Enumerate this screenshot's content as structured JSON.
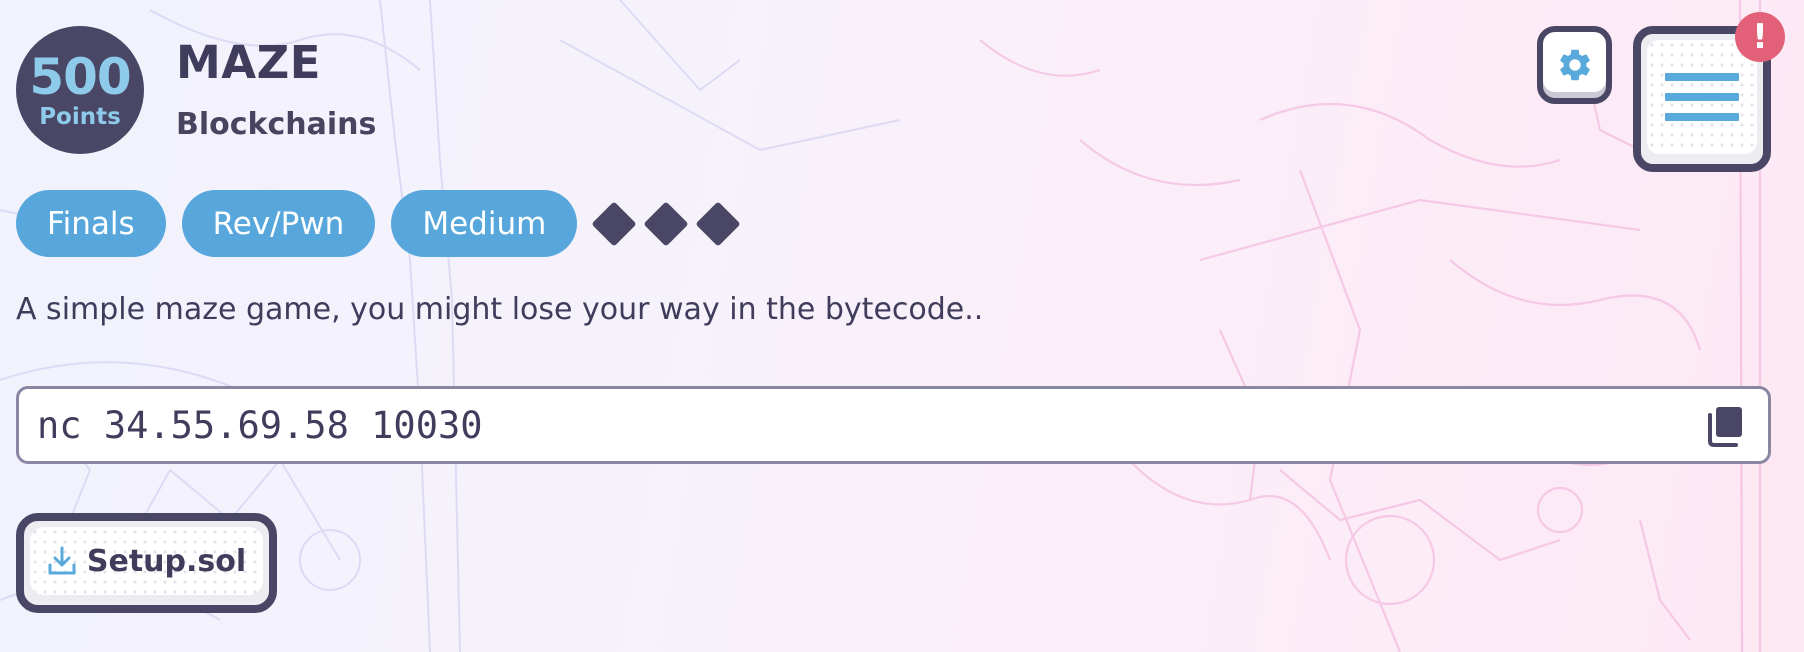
{
  "challenge": {
    "points_value": "500",
    "points_label": "Points",
    "title": "MAZE",
    "category": "Blockchains",
    "tags": [
      "Finals",
      "Rev/Pwn",
      "Medium"
    ],
    "difficulty_diamonds": 3,
    "description": "A simple maze game, you might lose your way in the bytecode..",
    "connection": "nc 34.55.69.58 10030",
    "download_label": "Setup.sol"
  },
  "header": {
    "alert_badge": "!",
    "settings_icon": "gear-icon",
    "menu_icon": "hamburger-menu-icon"
  },
  "colors": {
    "accent_blue": "#57a7dd",
    "dark": "#4a4766",
    "alert": "#e26178"
  }
}
